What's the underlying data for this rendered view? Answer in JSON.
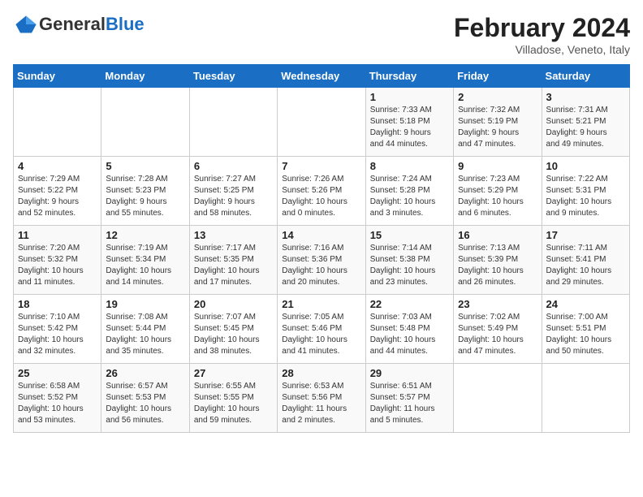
{
  "logo": {
    "general": "General",
    "blue": "Blue"
  },
  "title": "February 2024",
  "subtitle": "Villadose, Veneto, Italy",
  "days_of_week": [
    "Sunday",
    "Monday",
    "Tuesday",
    "Wednesday",
    "Thursday",
    "Friday",
    "Saturday"
  ],
  "weeks": [
    [
      {
        "day": "",
        "detail": ""
      },
      {
        "day": "",
        "detail": ""
      },
      {
        "day": "",
        "detail": ""
      },
      {
        "day": "",
        "detail": ""
      },
      {
        "day": "1",
        "detail": "Sunrise: 7:33 AM\nSunset: 5:18 PM\nDaylight: 9 hours\nand 44 minutes."
      },
      {
        "day": "2",
        "detail": "Sunrise: 7:32 AM\nSunset: 5:19 PM\nDaylight: 9 hours\nand 47 minutes."
      },
      {
        "day": "3",
        "detail": "Sunrise: 7:31 AM\nSunset: 5:21 PM\nDaylight: 9 hours\nand 49 minutes."
      }
    ],
    [
      {
        "day": "4",
        "detail": "Sunrise: 7:29 AM\nSunset: 5:22 PM\nDaylight: 9 hours\nand 52 minutes."
      },
      {
        "day": "5",
        "detail": "Sunrise: 7:28 AM\nSunset: 5:23 PM\nDaylight: 9 hours\nand 55 minutes."
      },
      {
        "day": "6",
        "detail": "Sunrise: 7:27 AM\nSunset: 5:25 PM\nDaylight: 9 hours\nand 58 minutes."
      },
      {
        "day": "7",
        "detail": "Sunrise: 7:26 AM\nSunset: 5:26 PM\nDaylight: 10 hours\nand 0 minutes."
      },
      {
        "day": "8",
        "detail": "Sunrise: 7:24 AM\nSunset: 5:28 PM\nDaylight: 10 hours\nand 3 minutes."
      },
      {
        "day": "9",
        "detail": "Sunrise: 7:23 AM\nSunset: 5:29 PM\nDaylight: 10 hours\nand 6 minutes."
      },
      {
        "day": "10",
        "detail": "Sunrise: 7:22 AM\nSunset: 5:31 PM\nDaylight: 10 hours\nand 9 minutes."
      }
    ],
    [
      {
        "day": "11",
        "detail": "Sunrise: 7:20 AM\nSunset: 5:32 PM\nDaylight: 10 hours\nand 11 minutes."
      },
      {
        "day": "12",
        "detail": "Sunrise: 7:19 AM\nSunset: 5:34 PM\nDaylight: 10 hours\nand 14 minutes."
      },
      {
        "day": "13",
        "detail": "Sunrise: 7:17 AM\nSunset: 5:35 PM\nDaylight: 10 hours\nand 17 minutes."
      },
      {
        "day": "14",
        "detail": "Sunrise: 7:16 AM\nSunset: 5:36 PM\nDaylight: 10 hours\nand 20 minutes."
      },
      {
        "day": "15",
        "detail": "Sunrise: 7:14 AM\nSunset: 5:38 PM\nDaylight: 10 hours\nand 23 minutes."
      },
      {
        "day": "16",
        "detail": "Sunrise: 7:13 AM\nSunset: 5:39 PM\nDaylight: 10 hours\nand 26 minutes."
      },
      {
        "day": "17",
        "detail": "Sunrise: 7:11 AM\nSunset: 5:41 PM\nDaylight: 10 hours\nand 29 minutes."
      }
    ],
    [
      {
        "day": "18",
        "detail": "Sunrise: 7:10 AM\nSunset: 5:42 PM\nDaylight: 10 hours\nand 32 minutes."
      },
      {
        "day": "19",
        "detail": "Sunrise: 7:08 AM\nSunset: 5:44 PM\nDaylight: 10 hours\nand 35 minutes."
      },
      {
        "day": "20",
        "detail": "Sunrise: 7:07 AM\nSunset: 5:45 PM\nDaylight: 10 hours\nand 38 minutes."
      },
      {
        "day": "21",
        "detail": "Sunrise: 7:05 AM\nSunset: 5:46 PM\nDaylight: 10 hours\nand 41 minutes."
      },
      {
        "day": "22",
        "detail": "Sunrise: 7:03 AM\nSunset: 5:48 PM\nDaylight: 10 hours\nand 44 minutes."
      },
      {
        "day": "23",
        "detail": "Sunrise: 7:02 AM\nSunset: 5:49 PM\nDaylight: 10 hours\nand 47 minutes."
      },
      {
        "day": "24",
        "detail": "Sunrise: 7:00 AM\nSunset: 5:51 PM\nDaylight: 10 hours\nand 50 minutes."
      }
    ],
    [
      {
        "day": "25",
        "detail": "Sunrise: 6:58 AM\nSunset: 5:52 PM\nDaylight: 10 hours\nand 53 minutes."
      },
      {
        "day": "26",
        "detail": "Sunrise: 6:57 AM\nSunset: 5:53 PM\nDaylight: 10 hours\nand 56 minutes."
      },
      {
        "day": "27",
        "detail": "Sunrise: 6:55 AM\nSunset: 5:55 PM\nDaylight: 10 hours\nand 59 minutes."
      },
      {
        "day": "28",
        "detail": "Sunrise: 6:53 AM\nSunset: 5:56 PM\nDaylight: 11 hours\nand 2 minutes."
      },
      {
        "day": "29",
        "detail": "Sunrise: 6:51 AM\nSunset: 5:57 PM\nDaylight: 11 hours\nand 5 minutes."
      },
      {
        "day": "",
        "detail": ""
      },
      {
        "day": "",
        "detail": ""
      }
    ]
  ]
}
